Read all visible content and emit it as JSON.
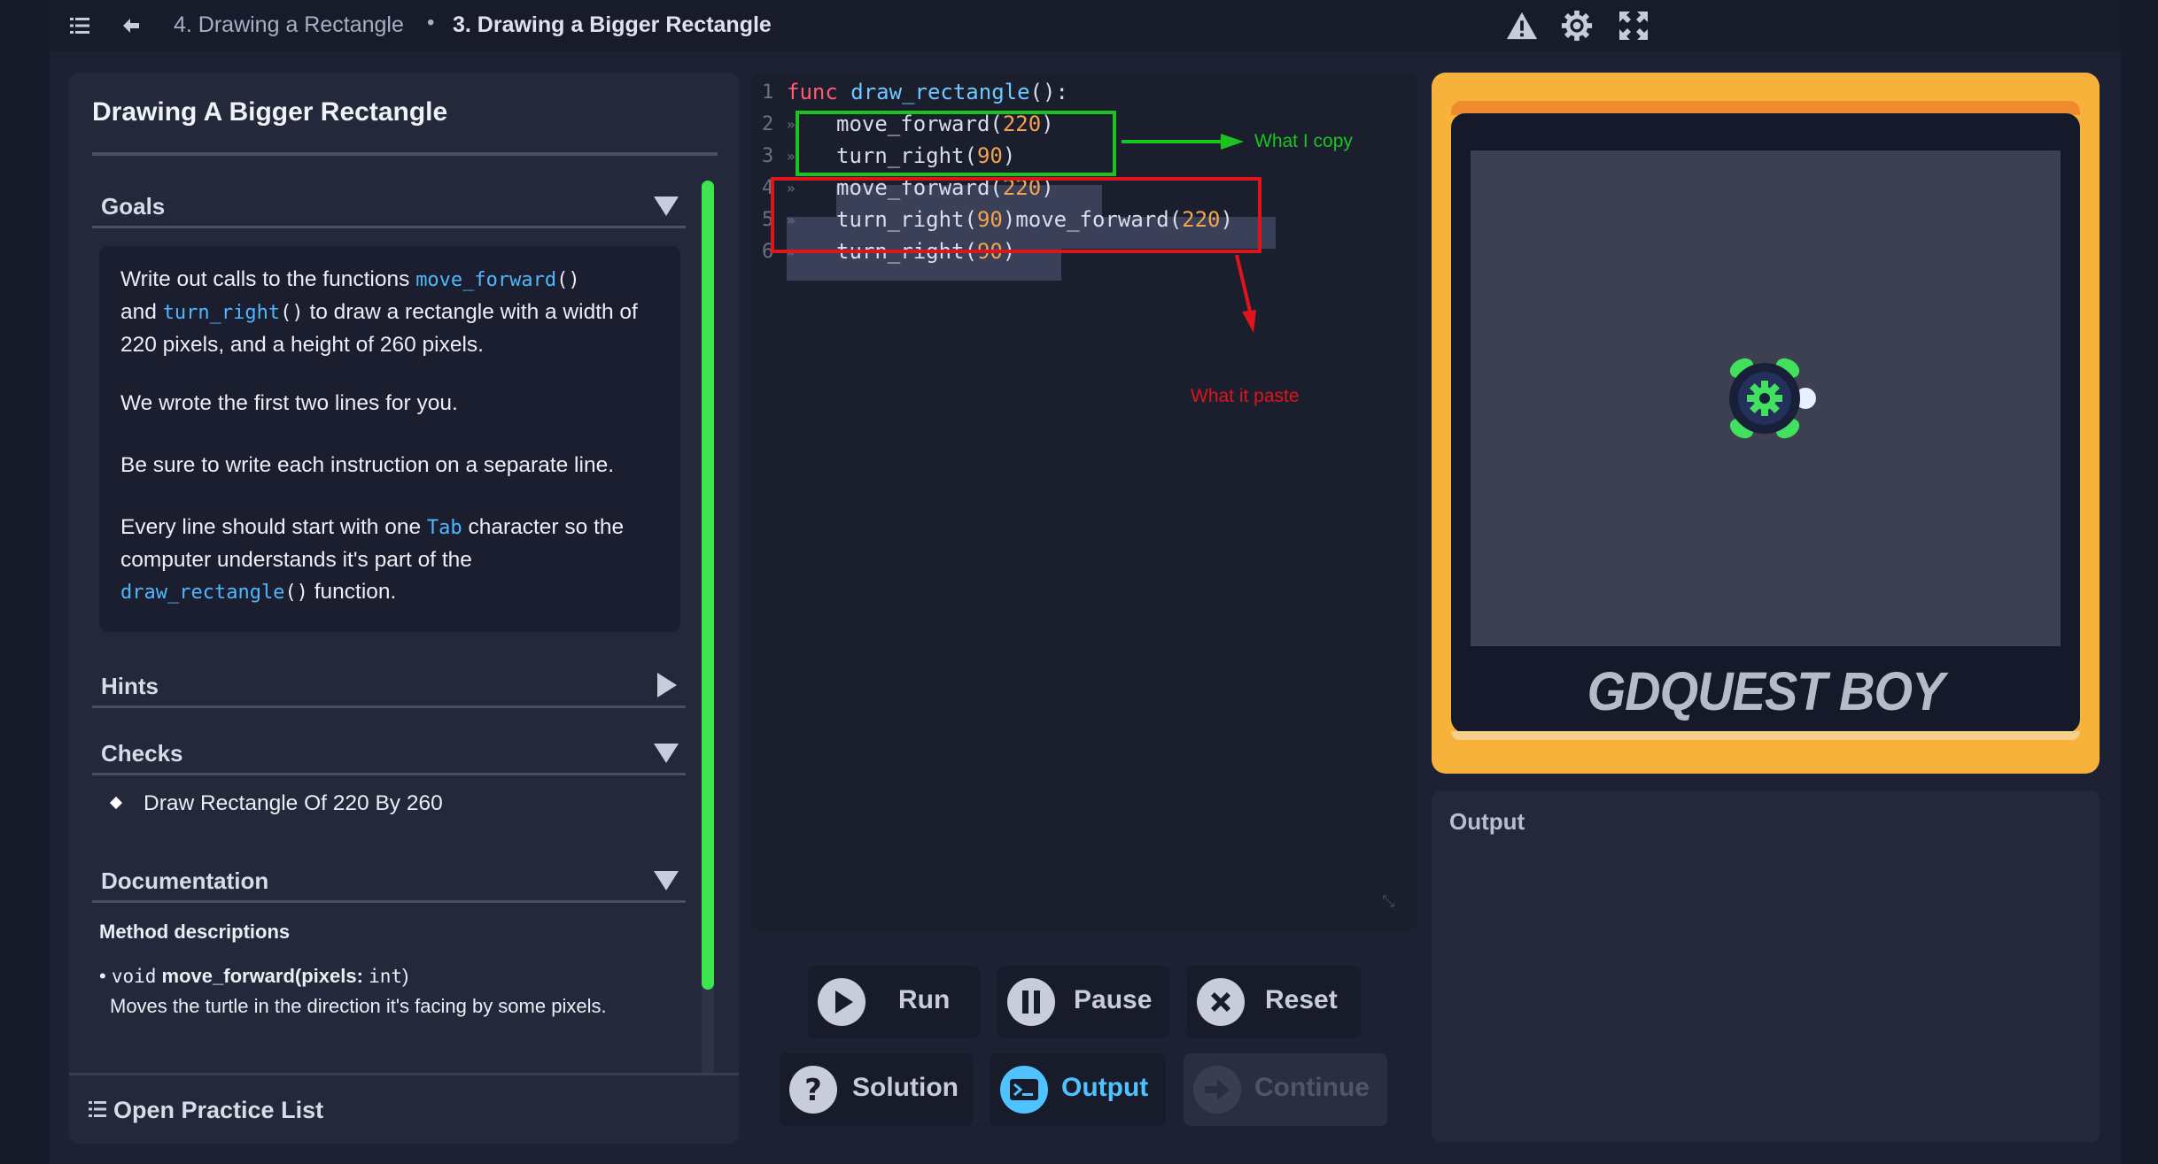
{
  "topbar": {
    "breadcrumb_parent": "4. Drawing a Rectangle",
    "breadcrumb_separator": "•",
    "breadcrumb_current": "3. Drawing a Bigger Rectangle"
  },
  "lesson": {
    "title": "Drawing A Bigger Rectangle",
    "goals": {
      "label": "Goals",
      "p1_a": "Write out calls to the functions ",
      "p1_fn1": "move_forward",
      "p1_fn1_paren": "()",
      "p1_b": "and ",
      "p1_fn2": "turn_right",
      "p1_fn2_paren": "()",
      "p1_c": " to draw a rectangle with a width of 220 pixels, and a height of 260 pixels.",
      "p2": "We wrote the first two lines for you.",
      "p3": "Be sure to write each instruction on a separate line.",
      "p4_a": "Every line should start with one ",
      "p4_tab": "Tab",
      "p4_b": " character so the computer understands it's part of the ",
      "p4_fn": "draw_rectangle",
      "p4_fn_paren": "()",
      "p4_c": " function."
    },
    "hints_label": "Hints",
    "checks": {
      "label": "Checks",
      "items": [
        "Draw Rectangle Of 220 By 260"
      ]
    },
    "documentation": {
      "label": "Documentation",
      "method_heading": "Method descriptions",
      "sig_bullet": "•",
      "sig_type": "void",
      "sig_name": "move_forward",
      "sig_param": "(pixels: ",
      "sig_param_type": "int",
      "sig_close": ")",
      "desc": "Moves the turtle in the direction it's facing by some pixels."
    },
    "practice_list": "Open Practice List"
  },
  "editor": {
    "lines": [
      {
        "n": "1",
        "parts": [
          [
            "func",
            "kw-func"
          ],
          [
            " ",
            "kw-plain"
          ],
          [
            "draw_rectangle",
            "kw-fn"
          ],
          [
            "():",
            "kw-plain"
          ]
        ]
      },
      {
        "n": "2",
        "parts": [
          [
            "move_forward",
            "kw-plain"
          ],
          [
            "(",
            "kw-plain"
          ],
          [
            "220",
            "kw-num"
          ],
          [
            ")",
            "kw-plain"
          ]
        ]
      },
      {
        "n": "3",
        "parts": [
          [
            "turn_right",
            "kw-plain"
          ],
          [
            "(",
            "kw-plain"
          ],
          [
            "90",
            "kw-num"
          ],
          [
            ")",
            "kw-plain"
          ]
        ]
      },
      {
        "n": "4",
        "parts": [
          [
            "move_forward",
            "kw-plain"
          ],
          [
            "(",
            "kw-plain"
          ],
          [
            "220",
            "kw-num"
          ],
          [
            ")",
            "kw-plain"
          ]
        ]
      },
      {
        "n": "5",
        "parts": [
          [
            "turn_right",
            "kw-plain"
          ],
          [
            "(",
            "kw-plain"
          ],
          [
            "90",
            "kw-num"
          ],
          [
            ")",
            "kw-plain"
          ],
          [
            "move_forward",
            "kw-plain"
          ],
          [
            "(",
            "kw-plain"
          ],
          [
            "220",
            "kw-num"
          ],
          [
            ")",
            "kw-plain"
          ]
        ]
      },
      {
        "n": "6",
        "parts": [
          [
            "turn_right",
            "kw-plain"
          ],
          [
            "(",
            "kw-plain"
          ],
          [
            "90",
            "kw-num"
          ],
          [
            ")",
            "kw-plain"
          ]
        ]
      }
    ],
    "annotation_copy": "What I copy",
    "annotation_paste": "What it paste",
    "annotation_copy_color": "#19c41f",
    "annotation_paste_color": "#e0141b"
  },
  "buttons": {
    "run": "Run",
    "pause": "Pause",
    "reset": "Reset",
    "solution": "Solution",
    "output": "Output",
    "continue": "Continue"
  },
  "game": {
    "brand": "GDQUEST BOY",
    "frame_color": "#f7b23b"
  },
  "output": {
    "title": "Output"
  },
  "colors": {
    "accent": "#4fc2ff",
    "scroll_thumb": "#3ee64e"
  }
}
